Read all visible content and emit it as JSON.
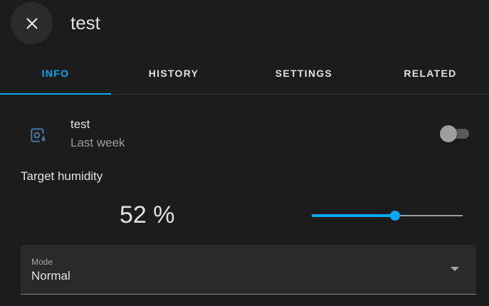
{
  "header": {
    "title": "test",
    "close_icon": "close-icon"
  },
  "tabs": [
    {
      "label": "INFO",
      "active": true
    },
    {
      "label": "HISTORY",
      "active": false
    },
    {
      "label": "SETTINGS",
      "active": false
    },
    {
      "label": "RELATED",
      "active": false
    }
  ],
  "entity": {
    "icon": "air-humidifier-icon",
    "name": "test",
    "secondary": "Last week",
    "toggle_on": false
  },
  "target_humidity": {
    "label": "Target humidity",
    "value_text": "52 %",
    "value": 52,
    "slider_fraction": 0.55
  },
  "mode": {
    "label": "Mode",
    "value": "Normal",
    "dropdown_icon": "chevron-down-icon"
  },
  "colors": {
    "accent": "#03a9f4",
    "background": "#1c1c1c",
    "icon": "#44739e"
  }
}
